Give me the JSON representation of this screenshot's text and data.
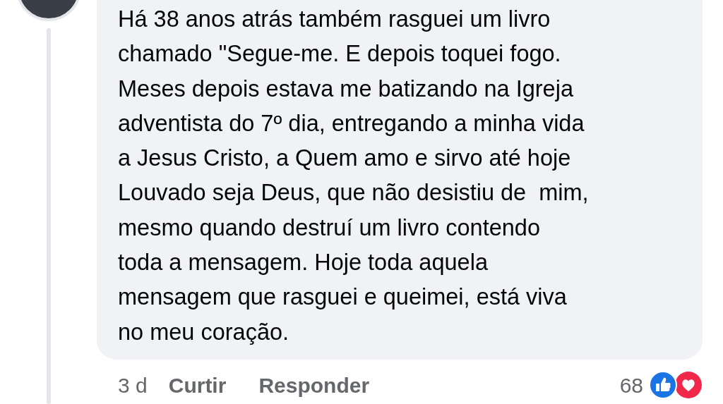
{
  "comment": {
    "lines": [
      "Há 38 anos atrás também rasguei um livro",
      "chamado \"Segue-me. E depois toquei fogo.",
      "Meses depois estava me batizando na Igreja",
      "adventista do 7º dia, entregando a minha vida",
      "a Jesus Cristo, a Quem amo e sirvo até hoje",
      "Louvado seja Deus, que não desistiu de  mim,",
      "mesmo quando destruí um livro contendo",
      "toda a mensagem. Hoje toda aquela",
      "mensagem que rasguei e queimei, está viva",
      "no meu coração."
    ]
  },
  "actions": {
    "time": "3 d",
    "like": "Curtir",
    "reply": "Responder",
    "reaction_count": "68"
  }
}
